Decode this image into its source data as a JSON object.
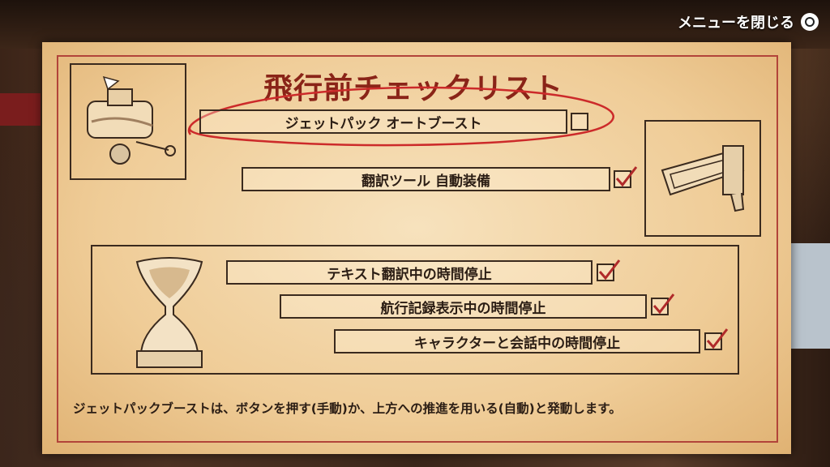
{
  "menu": {
    "close_label": "メニューを閉じる",
    "close_button_icon": "circle-button-icon"
  },
  "checklist": {
    "title": "飛行前チェックリスト",
    "items": [
      {
        "label": "ジェットパック オートブースト",
        "checked": false
      },
      {
        "label": "翻訳ツール 自動装備",
        "checked": true
      },
      {
        "label": "テキスト翻訳中の時間停止",
        "checked": true
      },
      {
        "label": "航行記録表示中の時間停止",
        "checked": true
      },
      {
        "label": "キャラクターと会話中の時間停止",
        "checked": true
      }
    ],
    "description": "ジェットパックブーストは、ボタンを押す(手動)か、上方への推進を用いる(自動)と発動します。"
  },
  "colors": {
    "paper": "#efcc97",
    "ink": "#2b1d14",
    "accent_red": "#b02a2a"
  }
}
